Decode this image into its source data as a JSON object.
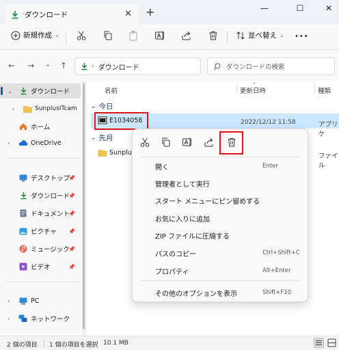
{
  "window": {
    "tab_title": "ダウンロード",
    "tab_close": "✕",
    "new_tab": "+",
    "minimize": "—",
    "maximize": "☐",
    "close": "✕"
  },
  "toolbar": {
    "new_label": "新規作成",
    "sort_label": "並べ替え",
    "more": "•••"
  },
  "address": {
    "path": "ダウンロード",
    "search_placeholder": "ダウンロードの検索"
  },
  "sidebar": {
    "items": [
      {
        "label": "ダウンロード"
      },
      {
        "label": "SunplusITcam"
      },
      {
        "label": "ホーム"
      },
      {
        "label": "OneDrive"
      },
      {
        "label": "デスクトップ"
      },
      {
        "label": "ダウンロード"
      },
      {
        "label": "ドキュメント"
      },
      {
        "label": "ピクチャ"
      },
      {
        "label": "ミュージック"
      },
      {
        "label": "ビデオ"
      },
      {
        "label": "PC"
      },
      {
        "label": "ネットワーク"
      }
    ]
  },
  "columns": {
    "name": "名前",
    "date": "更新日時",
    "type": "種類"
  },
  "groups": {
    "today": "今日",
    "last_month": "先月"
  },
  "files": [
    {
      "name": "E1034058",
      "date": "2022/12/12 11:58",
      "type": "アプリケ"
    },
    {
      "name": "Sunplus",
      "date": "",
      "type": "ファイル"
    }
  ],
  "context_menu": {
    "items": [
      {
        "label": "開く",
        "key": "Enter"
      },
      {
        "label": "管理者として実行",
        "key": ""
      },
      {
        "label": "スタート メニューにピン留めする",
        "key": ""
      },
      {
        "label": "お気に入りに追加",
        "key": ""
      },
      {
        "label": "ZIP ファイルに圧縮する",
        "key": ""
      },
      {
        "label": "パスのコピー",
        "key": "Ctrl+Shift+C"
      },
      {
        "label": "プロパティ",
        "key": "Alt+Enter"
      },
      {
        "label": "その他のオプションを表示",
        "key": "Shift+F10"
      }
    ]
  },
  "status": {
    "count": "2 個の項目",
    "selected": "1 個の項目を選択",
    "size": "10.1 MB"
  },
  "colors": {
    "accent": "#005fb8",
    "selection": "#cce8ff",
    "highlight_red": "#e0131b",
    "download_green": "#1f8a3a",
    "folder_yellow": "#f2c14e"
  }
}
